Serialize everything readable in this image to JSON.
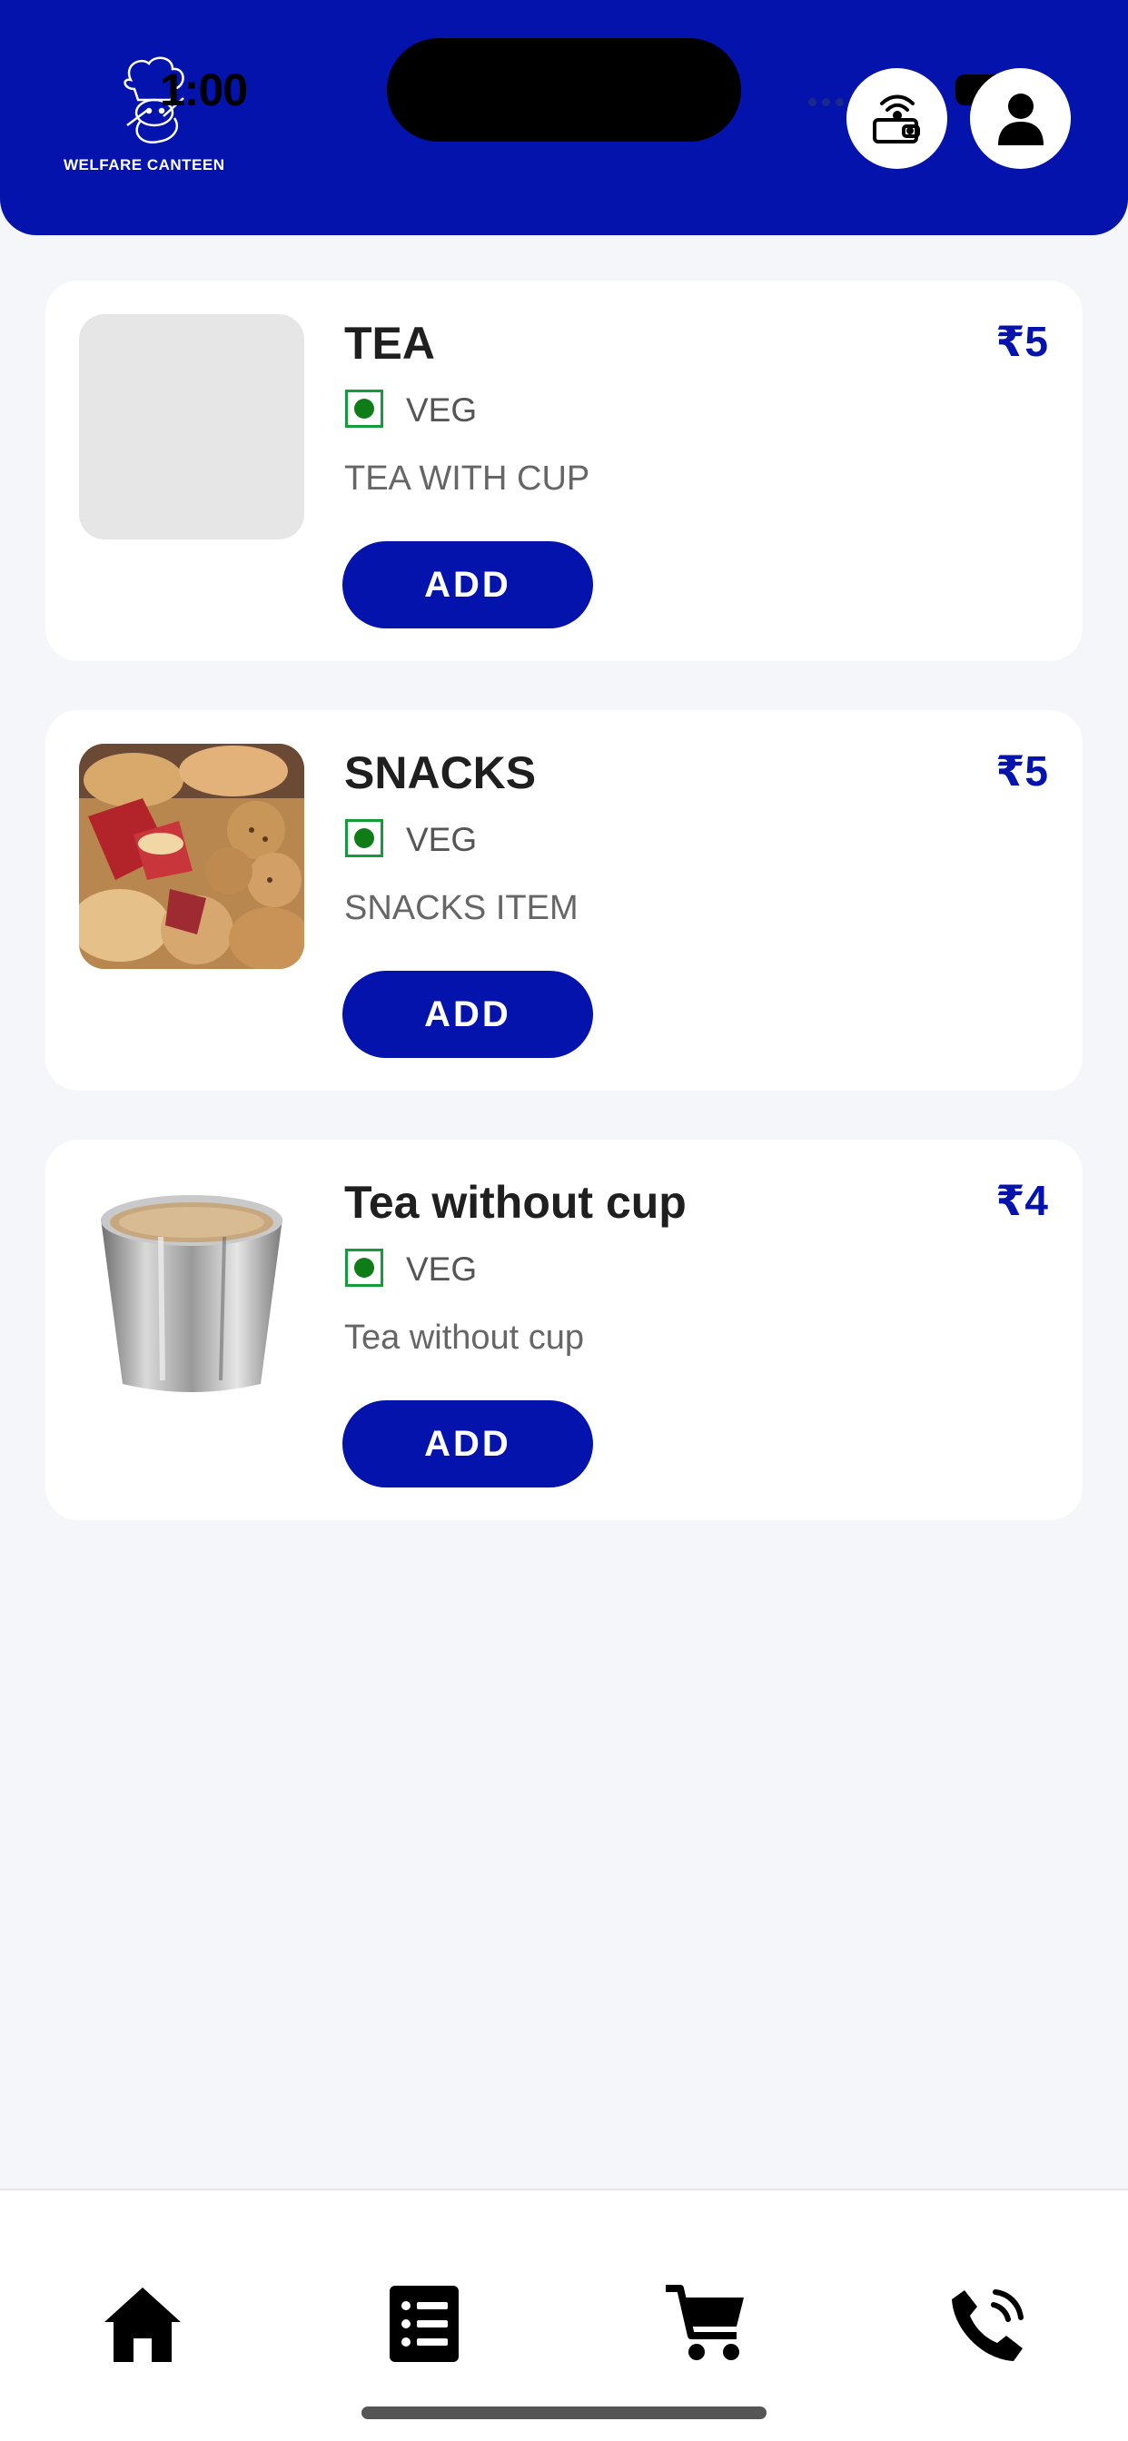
{
  "header": {
    "brand_text": "WELFARE CANTEEN",
    "status_time": "1:00",
    "wallet_icon": "wallet-icon",
    "profile_icon": "user-icon",
    "color": "#0313ac"
  },
  "menu": {
    "currency_symbol": "₹",
    "add_label": "ADD",
    "items": [
      {
        "name": "TEA",
        "price": "₹5",
        "tag": "VEG",
        "description": "TEA WITH CUP",
        "image": "placeholder"
      },
      {
        "name": "SNACKS",
        "price": "₹5",
        "tag": "VEG",
        "description": "SNACKS ITEM",
        "image": "snacks-photo"
      },
      {
        "name": "Tea without cup",
        "price": "₹4",
        "tag": "VEG",
        "description": "Tea without cup",
        "image": "steel-tumbler-photo"
      }
    ]
  },
  "bottom_nav": {
    "items": [
      {
        "icon": "home-icon"
      },
      {
        "icon": "list-icon"
      },
      {
        "icon": "cart-icon"
      },
      {
        "icon": "phone-icon"
      }
    ]
  }
}
